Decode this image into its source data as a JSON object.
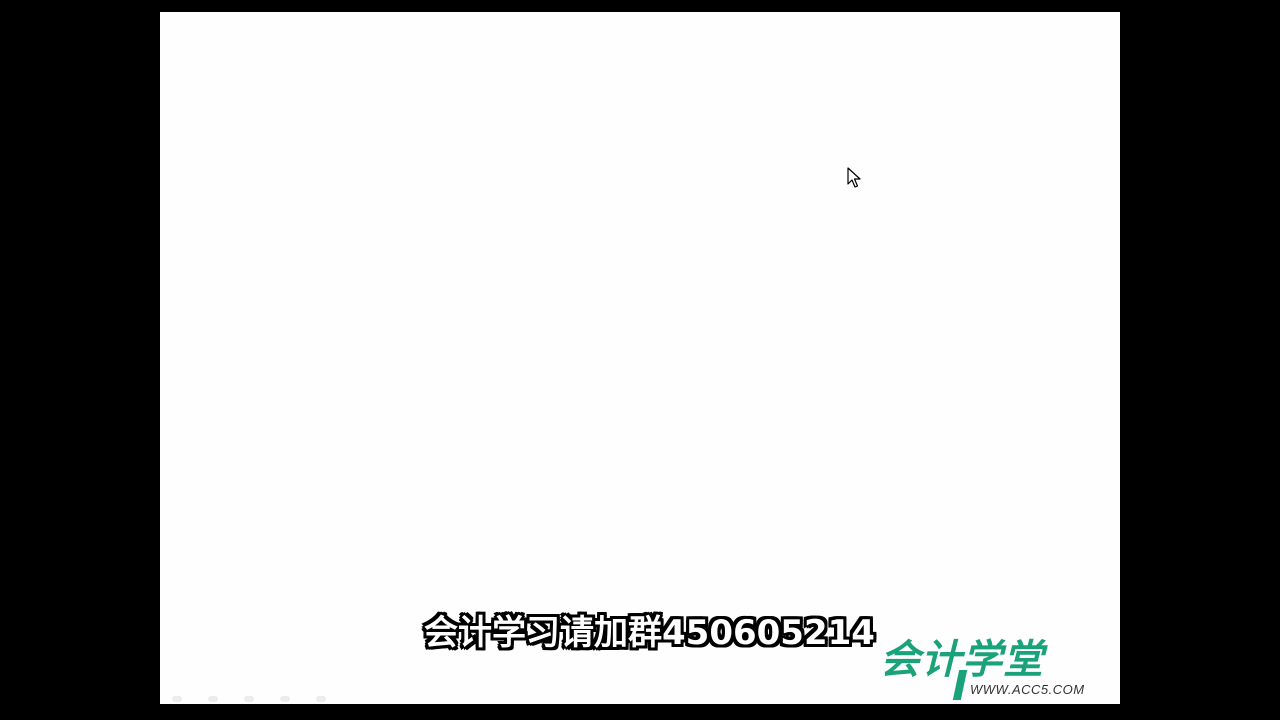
{
  "slide": {
    "subtitle": "会计学习请加群450605214"
  },
  "logo": {
    "name": "会计学堂",
    "url": "WWW.ACC5.COM",
    "color": "#1aa37a"
  },
  "icons": {
    "cursor": "mouse-pointer-icon"
  }
}
